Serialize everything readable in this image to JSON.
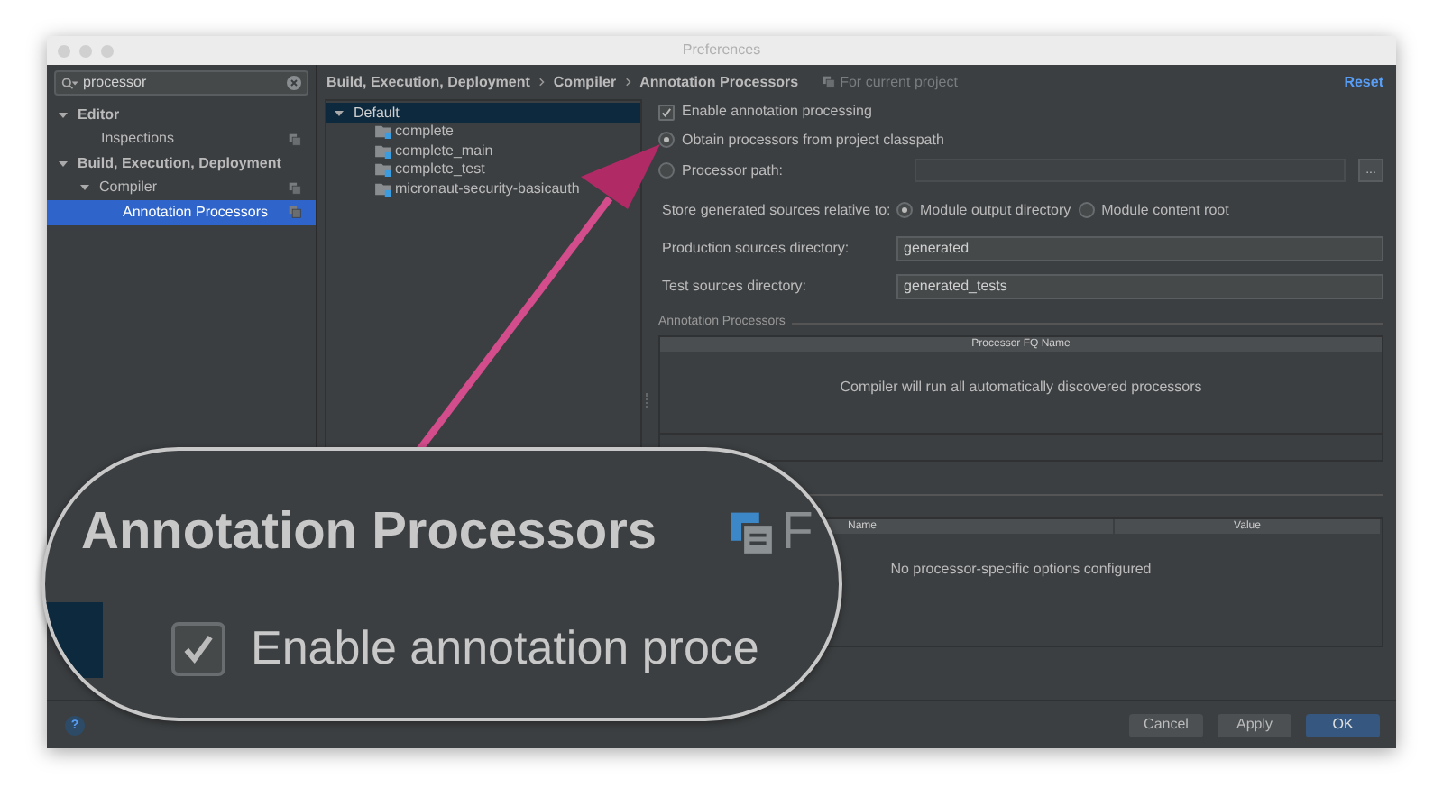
{
  "window": {
    "title": "Preferences"
  },
  "search": {
    "value": "processor"
  },
  "sidebar": {
    "items": [
      {
        "label": "Editor",
        "expanded": true,
        "selected": false,
        "scoped": false,
        "children": [
          {
            "label": "Inspections",
            "selected": false,
            "scoped": true
          }
        ]
      },
      {
        "label": "Build, Execution, Deployment",
        "expanded": true,
        "selected": false,
        "scoped": false,
        "children": [
          {
            "label": "Compiler",
            "expanded": true,
            "selected": false,
            "scoped": true,
            "children": [
              {
                "label": "Annotation Processors",
                "selected": true,
                "scoped": true
              }
            ]
          }
        ]
      }
    ]
  },
  "breadcrumb": [
    "Build, Execution, Deployment",
    "Compiler",
    "Annotation Processors"
  ],
  "scope_note": "For current project",
  "reset": "Reset",
  "profiles": [
    {
      "label": "Default",
      "expanded": true,
      "selected": true,
      "children": [
        {
          "label": "complete",
          "selected": false
        },
        {
          "label": "complete_main",
          "selected": false
        },
        {
          "label": "complete_test",
          "selected": false
        },
        {
          "label": "micronaut-security-basicauth",
          "selected": false
        }
      ]
    }
  ],
  "enable_processing": {
    "label": "Enable annotation processing",
    "checked": true
  },
  "processor_source": [
    {
      "label": "Obtain processors from project classpath",
      "selected": true
    },
    {
      "label": "Processor path:",
      "selected": false
    }
  ],
  "browse_button": "...",
  "store_relative": {
    "label": "Store generated sources relative to:",
    "options": [
      {
        "label": "Module output directory",
        "selected": true
      },
      {
        "label": "Module content root",
        "selected": false
      }
    ]
  },
  "fields": [
    {
      "label": "Production sources directory:",
      "value": "generated"
    },
    {
      "label": "Test sources directory:",
      "value": "generated_tests"
    }
  ],
  "processors_section": {
    "title": "Annotation Processors",
    "columns": [
      "Processor FQ Name"
    ],
    "empty_text": "Compiler will run all automatically discovered processors"
  },
  "options_table": {
    "columns": [
      "Name",
      "Value"
    ],
    "empty_text": "No processor-specific options configured"
  },
  "help": "?",
  "buttons": [
    {
      "label": "Cancel",
      "kind": "secondary"
    },
    {
      "label": "Apply",
      "kind": "secondary"
    },
    {
      "label": "OK",
      "kind": "primary"
    }
  ],
  "magnifier": {
    "title": "Annotation Processors",
    "note": "F",
    "checkbox": {
      "label": "Enable annotation proce",
      "checked": true
    }
  }
}
